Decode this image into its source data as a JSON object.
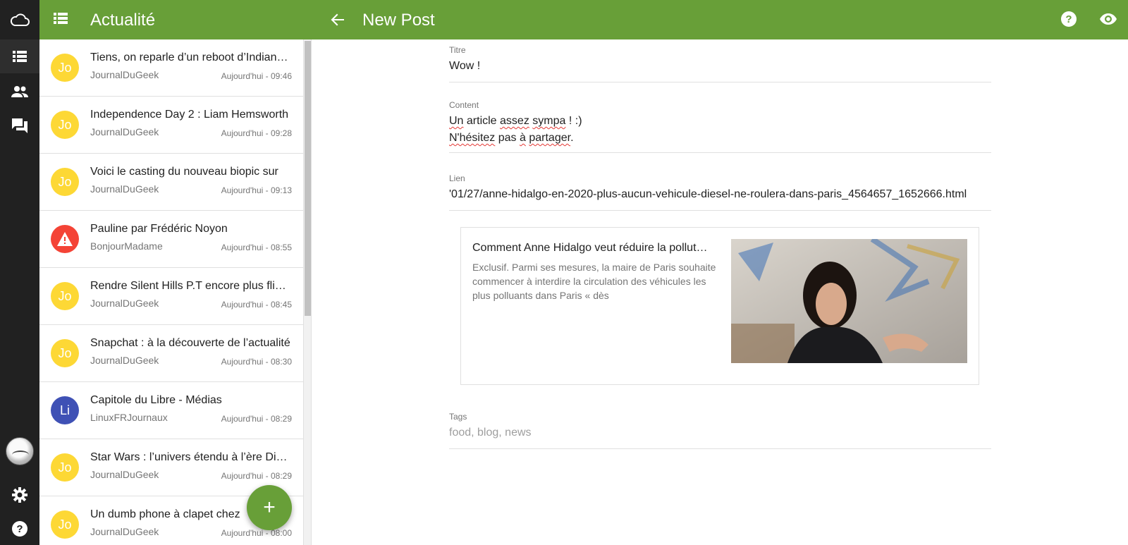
{
  "header": {
    "list_title": "Actualité",
    "editor_title": "New Post"
  },
  "feed": {
    "items": [
      {
        "initials": "Jo",
        "title": "Tiens, on reparle d’un reboot d’Indiana Jones",
        "source": "JournalDuGeek",
        "time": "Aujourd'hui - 09:46",
        "color": "#fdd835"
      },
      {
        "initials": "Jo",
        "title": "Independence Day 2 : Liam Hemsworth",
        "source": "JournalDuGeek",
        "time": "Aujourd'hui - 09:28",
        "color": "#fdd835"
      },
      {
        "initials": "Jo",
        "title": "Voici le casting du nouveau biopic sur",
        "source": "JournalDuGeek",
        "time": "Aujourd'hui - 09:13",
        "color": "#fdd835"
      },
      {
        "initials": "",
        "title": "Pauline par Frédéric Noyon",
        "source": "BonjourMadame",
        "time": "Aujourd'hui - 08:55",
        "color": "#f44336",
        "icon": "warning-icon"
      },
      {
        "initials": "Jo",
        "title": "Rendre Silent Hills P.T encore plus flippant",
        "source": "JournalDuGeek",
        "time": "Aujourd'hui - 08:45",
        "color": "#fdd835"
      },
      {
        "initials": "Jo",
        "title": "Snapchat : à la découverte de l’actualité",
        "source": "JournalDuGeek",
        "time": "Aujourd'hui - 08:30",
        "color": "#fdd835"
      },
      {
        "initials": "Li",
        "title": "Capitole du Libre - Médias",
        "source": "LinuxFRJournaux",
        "time": "Aujourd'hui - 08:29",
        "color": "#3f51b5"
      },
      {
        "initials": "Jo",
        "title": "Star Wars : l’univers étendu à l’ère Disney",
        "source": "JournalDuGeek",
        "time": "Aujourd'hui - 08:29",
        "color": "#fdd835"
      },
      {
        "initials": "Jo",
        "title": "Un dumb phone à clapet chez",
        "source": "JournalDuGeek",
        "time": "Aujourd'hui - 08:00",
        "color": "#fdd835"
      }
    ]
  },
  "fab": {
    "label": "+"
  },
  "form": {
    "title_label": "Titre",
    "title_value": "Wow !",
    "content_label": "Content",
    "content_line1_words": [
      "Un",
      " article ",
      "assez",
      " ",
      "sympa",
      " ! :)"
    ],
    "content_line2_words": [
      "N'hésitez",
      " pas ",
      "à",
      " ",
      "partager",
      "."
    ],
    "link_label": "Lien",
    "link_value": "'01/27/anne-hidalgo-en-2020-plus-aucun-vehicule-diesel-ne-roulera-dans-paris_4564657_1652666.html",
    "tags_label": "Tags",
    "tags_placeholder": "food, blog, news"
  },
  "preview": {
    "title": "Comment Anne Hidalgo veut réduire la pollution",
    "description": "Exclusif. Parmi ses mesures, la maire de Paris souhaite commencer à interdire la circulation des véhicules les plus polluants dans Paris « dès"
  },
  "colors": {
    "primary": "#689f38",
    "rail": "#212121",
    "avatar_yellow": "#fdd835",
    "avatar_red": "#f44336",
    "avatar_indigo": "#3f51b5"
  }
}
